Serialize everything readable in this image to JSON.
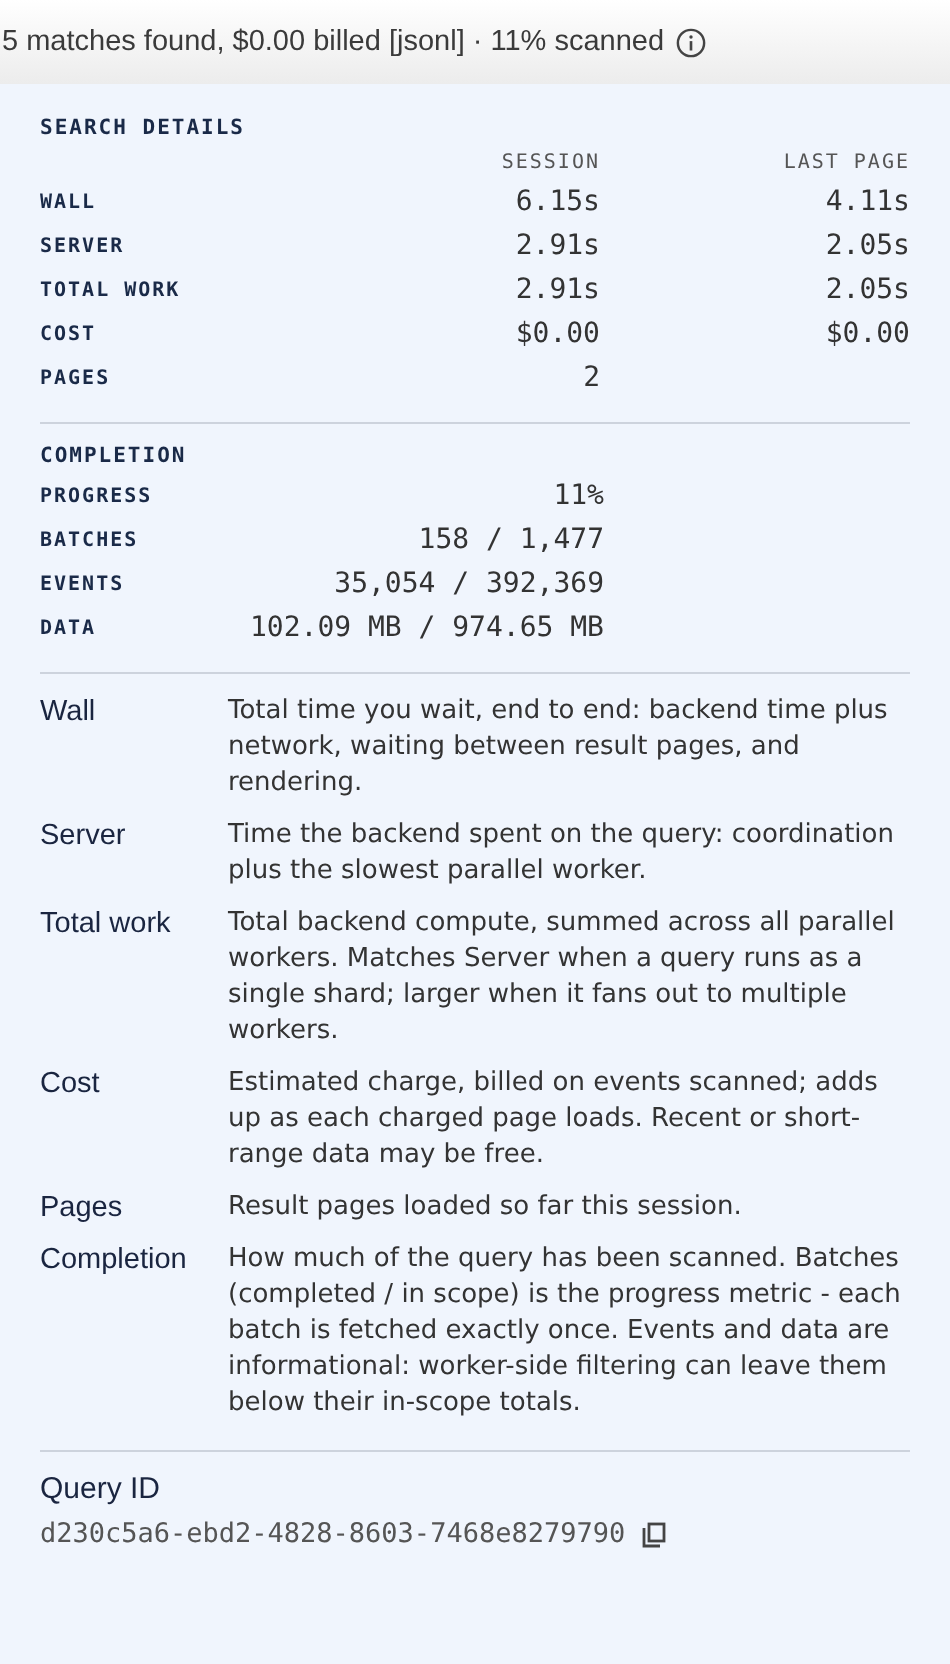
{
  "summary": {
    "text": "5 matches found, $0.00 billed [jsonl] · 11% scanned"
  },
  "search_details": {
    "title": "SEARCH DETAILS",
    "columns": [
      "SESSION",
      "LAST PAGE"
    ],
    "rows": [
      {
        "label": "WALL",
        "session": "6.15s",
        "last_page": "4.11s"
      },
      {
        "label": "SERVER",
        "session": "2.91s",
        "last_page": "2.05s"
      },
      {
        "label": "TOTAL WORK",
        "session": "2.91s",
        "last_page": "2.05s"
      },
      {
        "label": "COST",
        "session": "$0.00",
        "last_page": "$0.00"
      },
      {
        "label": "PAGES",
        "session": "2"
      }
    ]
  },
  "completion": {
    "title": "COMPLETION",
    "rows": [
      {
        "label": "PROGRESS",
        "value": "11%"
      },
      {
        "label": "BATCHES",
        "value": "158 / 1,477"
      },
      {
        "label": "EVENTS",
        "value": "35,054 / 392,369"
      },
      {
        "label": "DATA",
        "value": "102.09 MB / 974.65 MB"
      }
    ]
  },
  "glossary": [
    {
      "term": "Wall",
      "definition": "Total time you wait, end to end: backend time plus network, waiting between result pages, and rendering."
    },
    {
      "term": "Server",
      "definition": "Time the backend spent on the query: coordination plus the slowest parallel worker."
    },
    {
      "term": "Total work",
      "definition": "Total backend compute, summed across all parallel workers. Matches Server when a query runs as a single shard; larger when it fans out to multiple workers."
    },
    {
      "term": "Cost",
      "definition": "Estimated charge, billed on events scanned; adds up as each charged page loads. Recent or short-range data may be free."
    },
    {
      "term": "Pages",
      "definition": "Result pages loaded so far this session."
    },
    {
      "term": "Completion",
      "definition": "How much of the query has been scanned. Batches (completed / in scope) is the progress metric - each batch is fetched exactly once. Events and data are informational: worker-side filtering can leave them below their in-scope totals."
    }
  ],
  "query_id": {
    "label": "Query ID",
    "value": "d230c5a6-ebd2-4828-8603-7468e8279790"
  }
}
